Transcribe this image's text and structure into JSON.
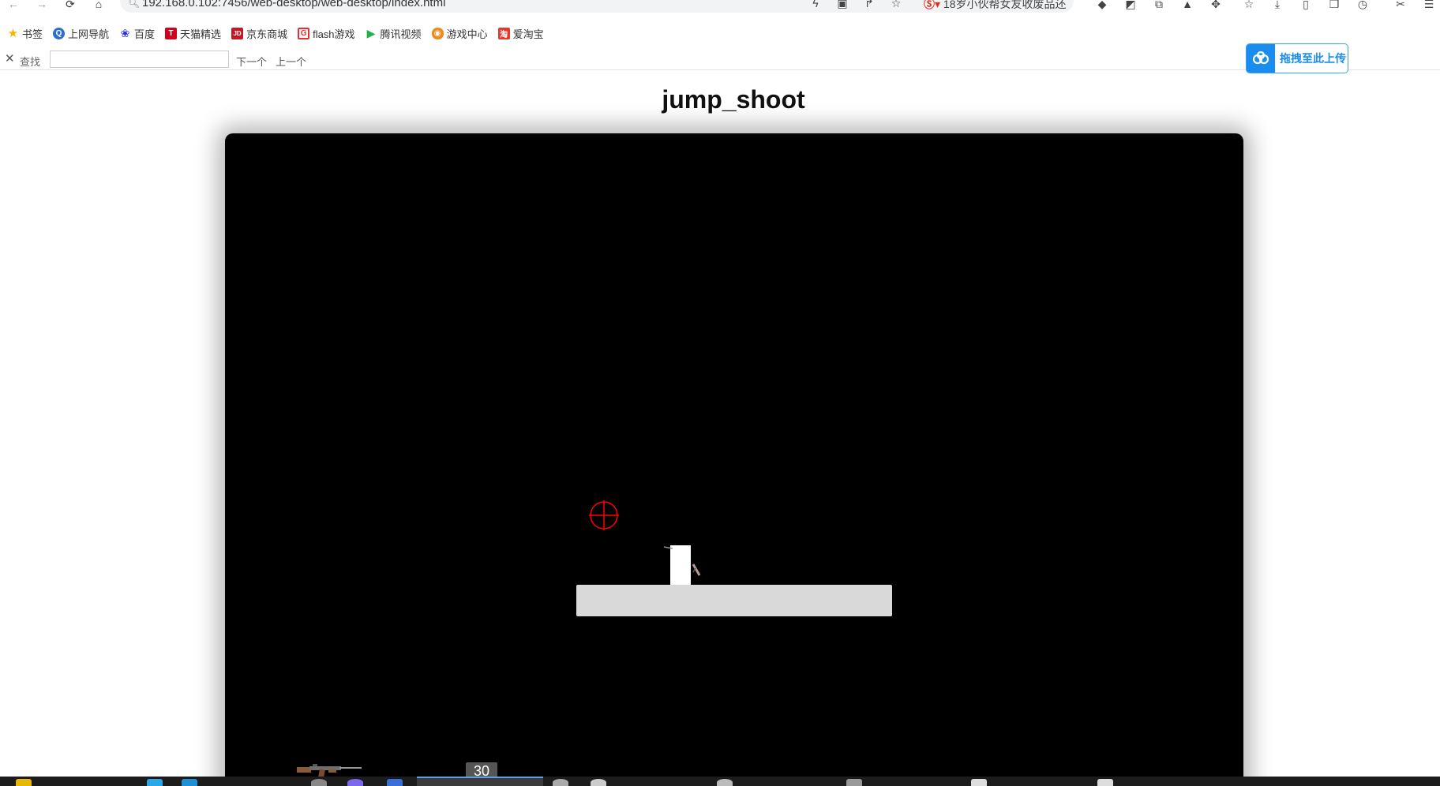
{
  "browser": {
    "url": "192.168.0.102:7456/web-desktop/web-desktop/index.html",
    "suggestion_text": "18岁小伙帮女友收废品还"
  },
  "bookmarks": [
    {
      "label": "书签",
      "icon": "star-icon",
      "color": "#f5b400"
    },
    {
      "label": "上网导航",
      "icon": "q-circle-icon",
      "color": "#2b6fd6"
    },
    {
      "label": "百度",
      "icon": "paw-icon",
      "color": "#2932e1"
    },
    {
      "label": "天猫精选",
      "icon": "tmall-icon",
      "color": "#d4001a"
    },
    {
      "label": "京东商城",
      "icon": "jd-icon",
      "color": "#c91623"
    },
    {
      "label": "flash游戏",
      "icon": "flash-game-icon",
      "color": "#e5302f"
    },
    {
      "label": "腾讯视频",
      "icon": "play-icon",
      "color": "#20b14a"
    },
    {
      "label": "游戏中心",
      "icon": "gamepad-icon",
      "color": "#f08a1c"
    },
    {
      "label": "爱淘宝",
      "icon": "taobao-icon",
      "color": "#e8362a"
    }
  ],
  "findbar": {
    "close_icon": "close-icon",
    "label": "查找",
    "value": "",
    "next_label": "下一个",
    "prev_label": "上一个"
  },
  "upload": {
    "label": "拖拽至此上传",
    "icon": "cloud-icon",
    "color": "#1a8cf0"
  },
  "page": {
    "title": "jump_shoot"
  },
  "game": {
    "background": "#000000",
    "crosshair_color": "#ff0000",
    "platform_color": "#d9d9d9",
    "player_color": "#ffffff",
    "weapon_icon": "rifle-icon",
    "ammo": "30"
  }
}
